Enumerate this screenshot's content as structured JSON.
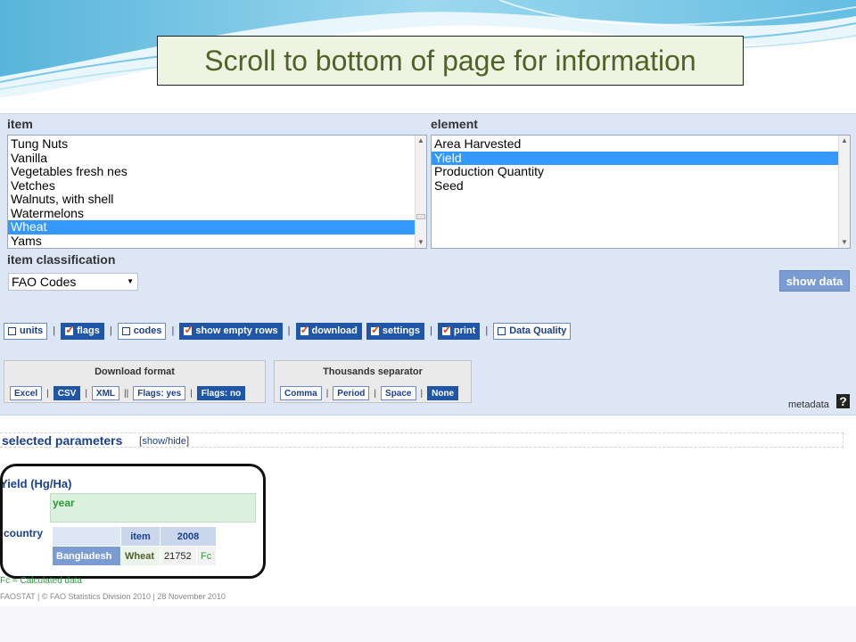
{
  "banner": {
    "text": "Scroll to bottom of page for information"
  },
  "item_list": {
    "label": "item",
    "options": [
      "Tung Nuts",
      "Vanilla",
      "Vegetables fresh nes",
      "Vetches",
      "Walnuts, with shell",
      "Watermelons",
      "Wheat",
      "Yams"
    ],
    "selected": "Wheat"
  },
  "element_list": {
    "label": "element",
    "options": [
      "Area Harvested",
      "Yield",
      "Production Quantity",
      "Seed"
    ],
    "selected": "Yield"
  },
  "classification": {
    "label": "item classification",
    "value": "FAO Codes"
  },
  "show_data_label": "show data",
  "toggles": [
    {
      "label": "units",
      "checked": false
    },
    {
      "label": "flags",
      "checked": true
    },
    {
      "label": "codes",
      "checked": false
    },
    {
      "label": "show empty rows",
      "checked": true
    },
    {
      "label": "download",
      "checked": true
    },
    {
      "label": "settings",
      "checked": true
    },
    {
      "label": "print",
      "checked": true
    },
    {
      "label": "Data Quality",
      "checked": false
    }
  ],
  "download_format": {
    "title": "Download format",
    "options": [
      "Excel",
      "CSV",
      "XML",
      "Flags: yes",
      "Flags: no"
    ],
    "selected": [
      "CSV",
      "Flags: no"
    ]
  },
  "thousands_separator": {
    "title": "Thousands separator",
    "options": [
      "Comma",
      "Period",
      "Space",
      "None"
    ],
    "selected": [
      "None"
    ]
  },
  "metadata_label": "metadata",
  "help_icon": "?",
  "selected_parameters": {
    "title": "selected parameters",
    "toggle": "show/hide"
  },
  "result": {
    "title": "Yield (Hg/Ha)",
    "year_label": "year",
    "country_label": "country",
    "headers": [
      "item",
      "2008"
    ],
    "row": {
      "country": "Bangladesh",
      "item": "Wheat",
      "value": "21752",
      "flag": "Fc"
    }
  },
  "fc_note": "Fc = Calculated data",
  "footer": "FAOSTAT | © FAO Statistics Division 2010 | 28 November 2010",
  "colors": {
    "accent": "#1f56a8",
    "selection": "#3399ff",
    "panel": "#dde6f4",
    "banner_text": "#4f6228"
  }
}
